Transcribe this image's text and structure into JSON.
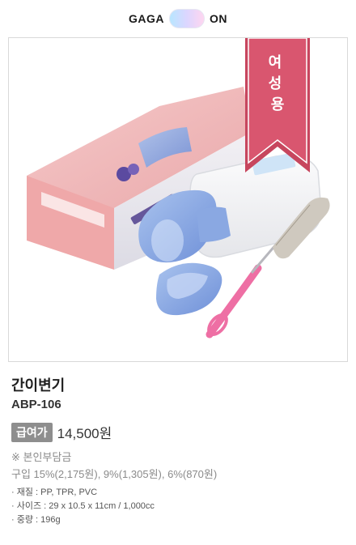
{
  "header": {
    "logo_left": "GAGA",
    "logo_right": "ON"
  },
  "photo": {
    "ribbon_text": "여성용",
    "ribbon_color": "#d64f6a"
  },
  "product": {
    "name": "간이변기",
    "code": "ABP-106",
    "badge": "급여가",
    "price": "14,500원",
    "note": "※ 본인부담금",
    "copay": "구입 15%(2,175원), 9%(1,305원), 6%(870원)",
    "specs": [
      {
        "label": "재질",
        "value": "PP, TPR, PVC"
      },
      {
        "label": "사이즈",
        "value": "29 x 10.5 x 11cm / 1,000cc"
      },
      {
        "label": "중량",
        "value": "196g"
      }
    ]
  }
}
